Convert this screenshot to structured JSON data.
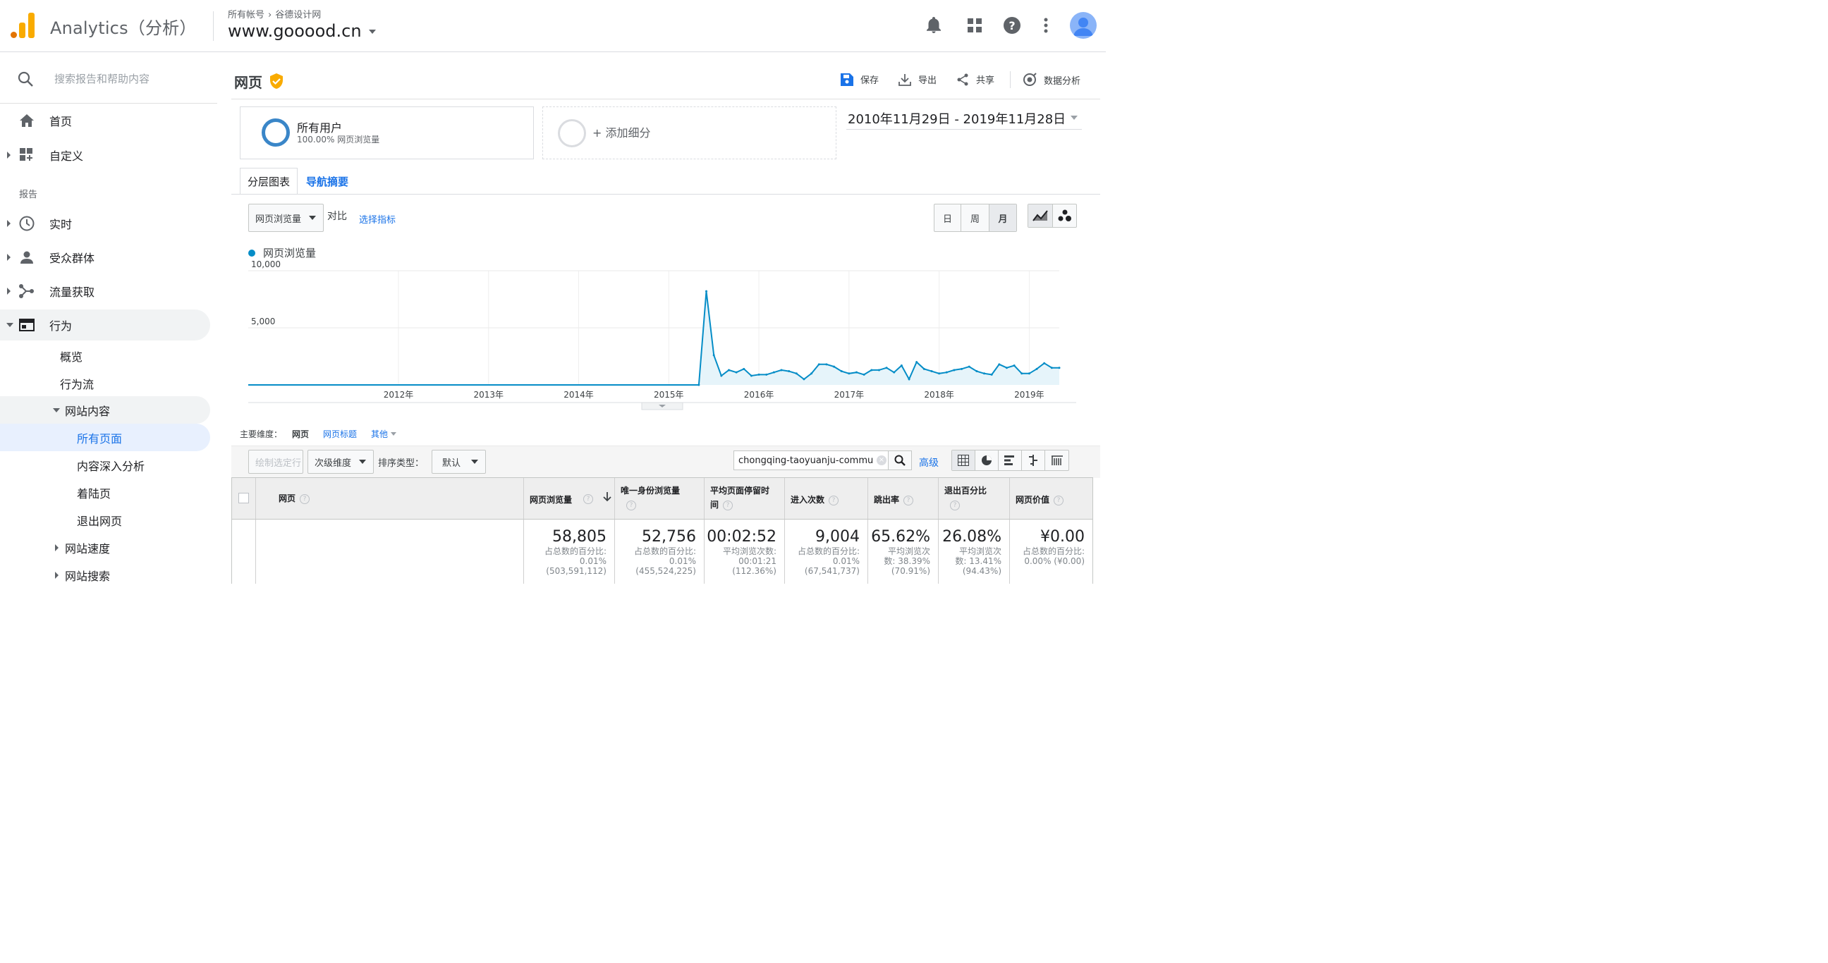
{
  "topbar": {
    "app_name": "Analytics（分析）",
    "breadcrumb_all": "所有帐号",
    "breadcrumb_account": "谷德设计网",
    "property": "www.gooood.cn"
  },
  "sidebar": {
    "search_placeholder": "搜索报告和帮助内容",
    "home": "首页",
    "customize": "自定义",
    "reports_label": "报告",
    "realtime": "实时",
    "audience": "受众群体",
    "acquisition": "流量获取",
    "behavior": "行为",
    "overview": "概览",
    "behavior_flow": "行为流",
    "site_content": "网站内容",
    "all_pages": "所有页面",
    "content_drilldown": "内容深入分析",
    "landing_pages": "着陆页",
    "exit_pages": "退出网页",
    "site_speed": "网站速度",
    "site_search": "网站搜索"
  },
  "main": {
    "title": "网页",
    "save": "保存",
    "export": "导出",
    "share": "共享",
    "insights": "数据分析",
    "segment_name": "所有用户",
    "segment_detail": "100.00% 网页浏览量",
    "add_segment": "+ 添加细分",
    "date_range": "2010年11月29日 - 2019年11月28日",
    "tab_explorer": "分层图表",
    "tab_navigation": "导航摘要",
    "metric_select": "网页浏览量",
    "vs": "对比",
    "select_metric": "选择指标",
    "granularity_day": "日",
    "granularity_week": "周",
    "granularity_month": "月",
    "legend": "网页浏览量",
    "primary_dimension_label": "主要维度：",
    "dim_page": "网页",
    "dim_page_title": "网页标题",
    "dim_other": "其他",
    "plot_rows": "绘制选定行",
    "secondary_dimension": "次级维度",
    "sort_type_label": "排序类型：",
    "sort_default": "默认",
    "search_value": "chongqing-taoyuanju-commu",
    "advanced": "高级"
  },
  "table": {
    "headers": {
      "page": "网页",
      "pageviews": "网页浏览量",
      "unique_pageviews": "唯一身份浏览量",
      "avg_time_line1": "平均页面停留时",
      "avg_time_line2": "间",
      "entrances": "进入次数",
      "bounce_rate": "跳出率",
      "exit_line1": "退出百分比",
      "page_value": "网页价值"
    },
    "totals": {
      "pageviews": "58,805",
      "pageviews_s1": "占总数的百分比:",
      "pageviews_s2": "0.01%",
      "pageviews_s3": "(503,591,112)",
      "unique": "52,756",
      "unique_s1": "占总数的百分比:",
      "unique_s2": "0.01%",
      "unique_s3": "(455,524,225)",
      "avg_time": "00:02:52",
      "avg_time_s1": "平均浏览次数:",
      "avg_time_s2": "00:01:21",
      "avg_time_s3": "(112.36%)",
      "entrances": "9,004",
      "entrances_s1": "占总数的百分比:",
      "entrances_s2": "0.01%",
      "entrances_s3": "(67,541,737)",
      "bounce": "65.62%",
      "bounce_s1": "平均浏览次",
      "bounce_s2": "数: 38.39%",
      "bounce_s3": "(70.91%)",
      "exit": "26.08%",
      "exit_s1": "平均浏览次",
      "exit_s2": "数: 13.41%",
      "exit_s3": "(94.43%)",
      "value": "¥0.00",
      "value_s1": "占总数的百分比:",
      "value_s2": "0.00% (¥0.00)"
    }
  },
  "colors": {
    "line": "#058dc7",
    "fill": "#e6f4fa",
    "accent": "#1a73e8",
    "logo_orange": "#f9ab00",
    "logo_dark": "#e37400"
  },
  "chart_data": {
    "type": "area",
    "series": [
      {
        "name": "网页浏览量",
        "x": [
          "2015-11",
          "2015-12",
          "2016-01",
          "2016-02",
          "2016-03",
          "2016-04",
          "2016-05",
          "2016-06",
          "2016-07",
          "2016-08",
          "2016-09",
          "2016-10",
          "2016-11",
          "2016-12",
          "2017-01",
          "2017-02",
          "2017-03",
          "2017-04",
          "2017-05",
          "2017-06",
          "2017-07",
          "2017-08",
          "2017-09",
          "2017-10",
          "2017-11",
          "2017-12",
          "2018-01",
          "2018-02",
          "2018-03",
          "2018-04",
          "2018-05",
          "2018-06",
          "2018-07",
          "2018-08",
          "2018-09",
          "2018-10",
          "2018-11",
          "2018-12",
          "2019-01",
          "2019-02",
          "2019-03",
          "2019-04",
          "2019-05",
          "2019-06",
          "2019-07",
          "2019-08",
          "2019-09",
          "2019-10",
          "2019-11"
        ],
        "values": [
          0,
          8200,
          2600,
          800,
          1300,
          1100,
          1400,
          800,
          900,
          900,
          1100,
          1300,
          1200,
          1000,
          500,
          1000,
          1800,
          1800,
          1600,
          1200,
          1000,
          1100,
          900,
          1300,
          1300,
          1500,
          1100,
          1700,
          500,
          2000,
          1400,
          1200,
          1000,
          1100,
          1300,
          1400,
          1600,
          1200,
          1000,
          900,
          1800,
          1500,
          1700,
          1000,
          1000,
          1400,
          1900,
          1500,
          1500
        ]
      }
    ],
    "x_tick_labels": [
      "2012年",
      "2013年",
      "2014年",
      "2015年",
      "2016年",
      "2017年",
      "2018年",
      "2019年"
    ],
    "x_range": [
      "2010-11",
      "2019-11"
    ],
    "y_tick_labels": [
      "5,000",
      "10,000"
    ],
    "ylim": [
      0,
      10000
    ],
    "grid": "vertical gridlines",
    "legend": "top-left"
  }
}
